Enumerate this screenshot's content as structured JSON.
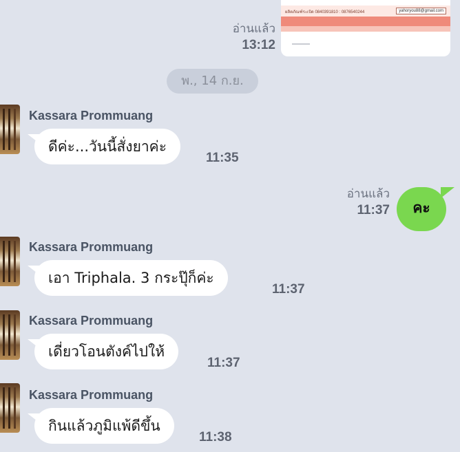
{
  "top_image": {
    "strip_text": "ผลิตภัณฑ์ระเบิด 0840391810 : 0876540244",
    "strip_email": "yahoryou88@gmail.com",
    "read_label": "อ่านแล้ว",
    "time": "13:12"
  },
  "date_divider": "พ., 14 ก.ย.",
  "messages": [
    {
      "sender": "Kassara Prommuang",
      "text": "ดีค่ะ...วันนี้สั่งยาค่ะ",
      "time": "11:35"
    },
    {
      "sender": "me",
      "text": "คะ",
      "read_label": "อ่านแล้ว",
      "time": "11:37"
    },
    {
      "sender": "Kassara Prommuang",
      "text": "เอา Triphala. 3 กระปุ๊ก็ค่ะ",
      "time": "11:37"
    },
    {
      "sender": "Kassara Prommuang",
      "text": "เดี่ยวโอนตังค์ไปให้",
      "time": "11:37"
    },
    {
      "sender": "Kassara Prommuang",
      "text": "กินแล้วภูมิแพ้ดีขึ้น",
      "time": "11:38"
    }
  ],
  "colors": {
    "background": "#dfe3ec",
    "sent_bubble": "#7ad74f",
    "received_bubble": "#ffffff"
  }
}
